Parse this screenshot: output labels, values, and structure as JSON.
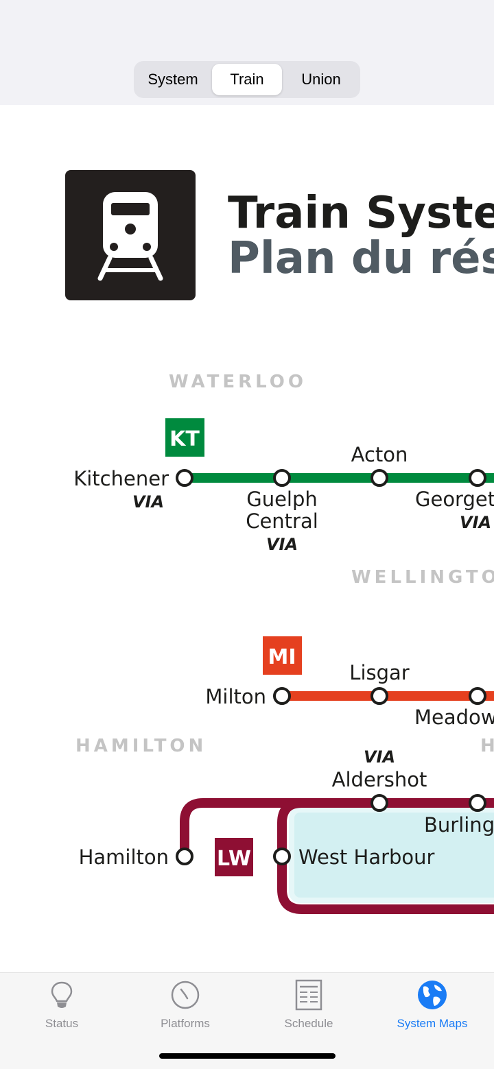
{
  "segments": [
    "System",
    "Train",
    "Union"
  ],
  "selected_segment": "Train",
  "map": {
    "title_en": "Train System",
    "title_fr": "Plan du rése",
    "regions": {
      "waterloo": "WATERLOO",
      "wellington": "WELLINGTO",
      "hamilton": "HAMILTON",
      "halton": "H"
    },
    "lines": {
      "kt": {
        "code": "KT",
        "color": "#008a3e"
      },
      "mi": {
        "code": "MI",
        "color": "#e5401f"
      },
      "lw": {
        "code": "LW",
        "color": "#8e0f33"
      }
    },
    "stations": {
      "kitchener": "Kitchener",
      "guelph_1": "Guelph",
      "guelph_2": "Central",
      "acton": "Acton",
      "georgetown": "Georget",
      "milton": "Milton",
      "lisgar": "Lisgar",
      "meadowvale": "Meadow",
      "aldershot": "Aldershot",
      "burlington": "Burling",
      "hamilton": "Hamilton",
      "west_harbour": "West Harbour"
    },
    "via_logo": "VIA"
  },
  "tabs": [
    {
      "label": "Status",
      "icon": "lightbulb-icon"
    },
    {
      "label": "Platforms",
      "icon": "clock-icon"
    },
    {
      "label": "Schedule",
      "icon": "schedule-icon"
    },
    {
      "label": "System Maps",
      "icon": "globe-icon"
    }
  ],
  "active_tab": "System Maps",
  "colors": {
    "accent": "#1a7cf5",
    "inactive": "#8e8e93"
  }
}
